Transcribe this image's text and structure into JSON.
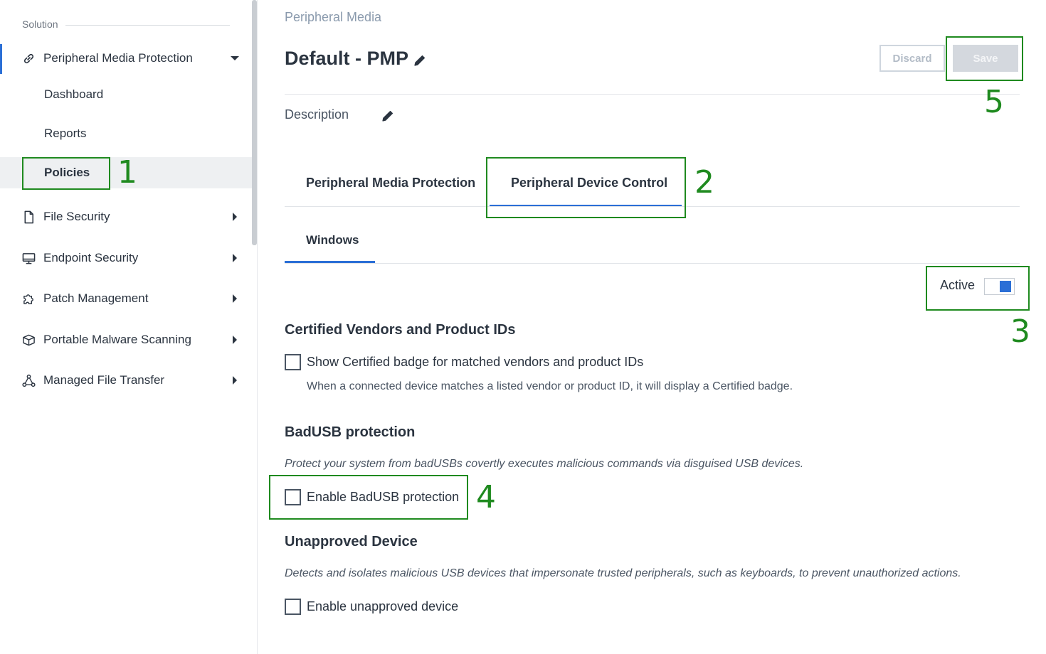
{
  "sidebar": {
    "section_label": "Solution",
    "items": [
      {
        "label": "Peripheral Media Protection",
        "icon": "link-icon",
        "expanded": true
      },
      {
        "label": "File Security",
        "icon": "file-icon"
      },
      {
        "label": "Endpoint Security",
        "icon": "monitor-icon"
      },
      {
        "label": "Patch Management",
        "icon": "puzzle-icon"
      },
      {
        "label": "Portable Malware Scanning",
        "icon": "box-icon"
      },
      {
        "label": "Managed File Transfer",
        "icon": "share-icon"
      }
    ],
    "sub_items": [
      {
        "label": "Dashboard"
      },
      {
        "label": "Reports"
      },
      {
        "label": "Policies",
        "selected": true
      }
    ]
  },
  "header": {
    "breadcrumb": "Peripheral Media",
    "title": "Default - PMP",
    "discard_label": "Discard",
    "save_label": "Save",
    "description_label": "Description"
  },
  "tabs": [
    {
      "label": "Peripheral Media Protection"
    },
    {
      "label": "Peripheral Device Control",
      "active": true
    }
  ],
  "subtabs": [
    {
      "label": "Windows",
      "active": true
    }
  ],
  "active_toggle": {
    "label": "Active",
    "on": true
  },
  "sections": {
    "certified": {
      "title": "Certified Vendors and Product IDs",
      "checkbox_label": "Show Certified badge for matched vendors and product IDs",
      "help": "When a connected device matches a listed vendor or product ID, it will display a Certified badge."
    },
    "badusb": {
      "title": "BadUSB protection",
      "description": "Protect your system from badUSBs covertly executes malicious commands via disguised USB devices.",
      "checkbox_label": "Enable BadUSB protection"
    },
    "unapproved": {
      "title": "Unapproved Device",
      "description": "Detects and isolates malicious USB devices that impersonate trusted peripherals, such as keyboards, to prevent unauthorized actions.",
      "checkbox_label": "Enable unapproved device"
    }
  },
  "annotations": [
    "1",
    "2",
    "3",
    "4",
    "5"
  ],
  "colors": {
    "accent": "#2b6fd6",
    "annotation": "#1f8a1f"
  }
}
